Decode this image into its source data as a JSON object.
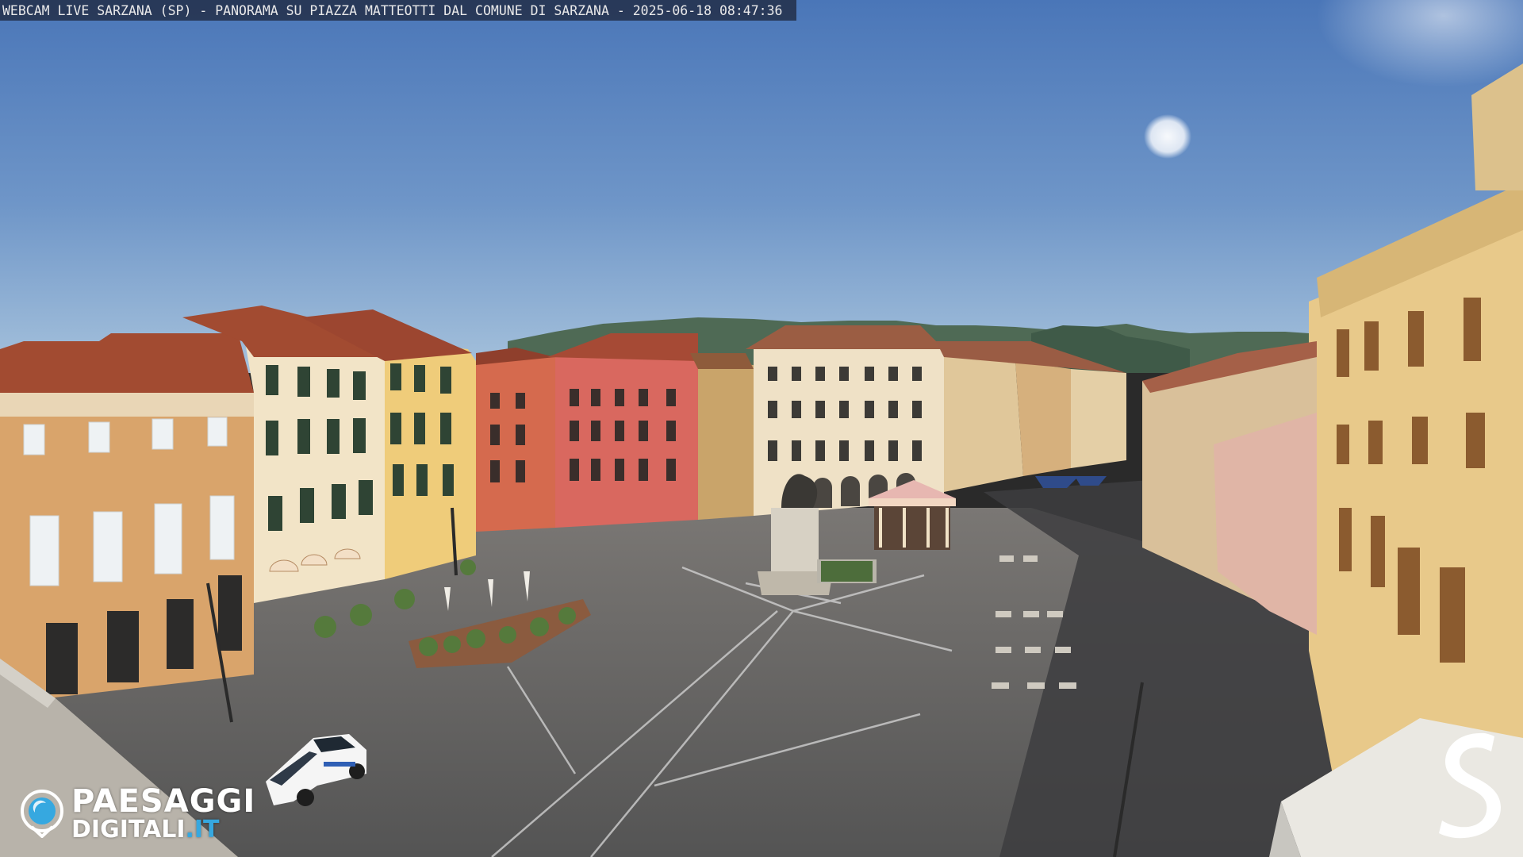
{
  "caption": {
    "text": "WEBCAM LIVE SARZANA (SP) - PANORAMA SU PIAZZA MATTEOTTI DAL COMUNE DI SARZANA - 2025-06-18  08:47:36"
  },
  "logo": {
    "icon": "camera-lens-icon",
    "line1": "PAESAGGI",
    "line2_word": "DIGITALI",
    "line2_tld": ".IT",
    "accent_color": "#36a8e0"
  },
  "brand_mark": {
    "icon": "letter-s-logo-icon",
    "color": "#ffffff"
  },
  "colors": {
    "sky_top": "#4a76b8",
    "sky_bottom": "#9bbcd8",
    "pavement": "#5f5f5f"
  }
}
